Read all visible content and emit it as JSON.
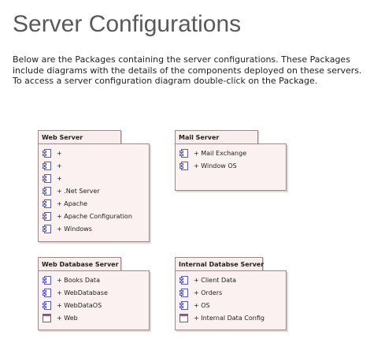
{
  "page": {
    "title": "Server Configurations",
    "intro": [
      "Below are the Packages containing the server configurations.  These Packages",
      "include diagrams with the details of the components deployed on these servers.",
      "  To access a server configuration diagram double-click on the Package."
    ]
  },
  "packages": {
    "web_server": {
      "name": "Web Server",
      "items": [
        {
          "label": "+",
          "icon": "component-icon"
        },
        {
          "label": "+",
          "icon": "component-icon"
        },
        {
          "label": "+",
          "icon": "component-icon"
        },
        {
          "label": "+ .Net Server",
          "icon": "component-icon"
        },
        {
          "label": "+ Apache",
          "icon": "component-icon"
        },
        {
          "label": "+ Apache Configuration",
          "icon": "component-icon"
        },
        {
          "label": "+ Windows",
          "icon": "component-icon"
        }
      ]
    },
    "mail_server": {
      "name": "Mail Server",
      "items": [
        {
          "label": "+ Mail Exchange",
          "icon": "component-icon"
        },
        {
          "label": "+ Window OS",
          "icon": "component-icon"
        }
      ]
    },
    "web_database_server": {
      "name": "Web Database Server",
      "items": [
        {
          "label": "+ Books Data",
          "icon": "component-icon"
        },
        {
          "label": "+ WebDatabase",
          "icon": "component-icon"
        },
        {
          "label": "+ WebDataOS",
          "icon": "component-icon"
        },
        {
          "label": "+ Web",
          "icon": "diagram-icon"
        }
      ]
    },
    "internal_database_server": {
      "name": "Internal Databse Server",
      "items": [
        {
          "label": "+ Client Data",
          "icon": "component-icon"
        },
        {
          "label": "+ Orders",
          "icon": "component-icon"
        },
        {
          "label": "+ OS",
          "icon": "component-icon"
        },
        {
          "label": "+ Internal Data Config",
          "icon": "diagram-icon"
        }
      ]
    }
  },
  "colors": {
    "package_fill": "#fbf1f1",
    "package_border": "#9a8a8a",
    "title_text": "#595959",
    "component_icon": "#5a5ab0",
    "diagram_icon_header": "#b04a8a"
  }
}
